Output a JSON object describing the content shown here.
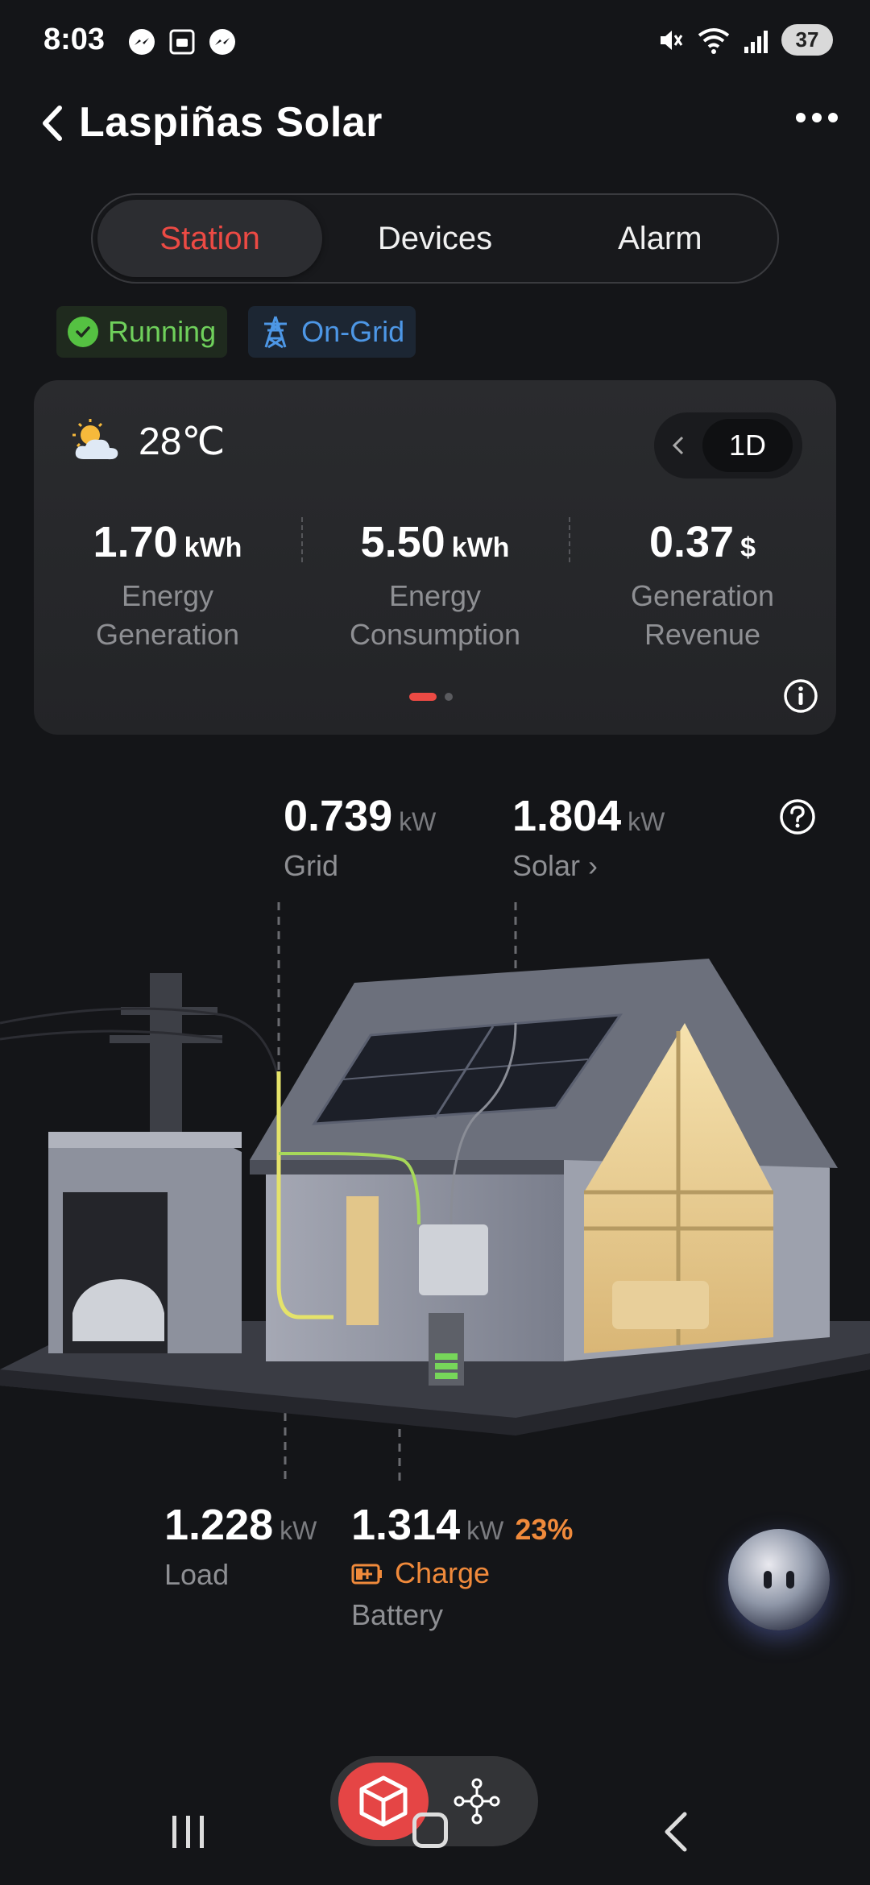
{
  "status_bar": {
    "time": "8:03",
    "battery": "37",
    "icons": [
      "messenger-icon",
      "screenshot-icon",
      "messenger-icon",
      "mute-icon",
      "wifi-icon",
      "signal-icon"
    ]
  },
  "header": {
    "title": "Laspiñas Solar"
  },
  "tabs": [
    {
      "label": "Station",
      "active": true
    },
    {
      "label": "Devices",
      "active": false
    },
    {
      "label": "Alarm",
      "active": false
    }
  ],
  "chips": {
    "running": "Running",
    "on_grid": "On-Grid"
  },
  "energy_card": {
    "temperature": "28",
    "temperature_unit": "℃",
    "period": "1D",
    "metrics": [
      {
        "value": "1.70",
        "unit": "kWh",
        "label_line1": "Energy",
        "label_line2": "Generation"
      },
      {
        "value": "5.50",
        "unit": "kWh",
        "label_line1": "Energy",
        "label_line2": "Consumption"
      },
      {
        "value": "0.37",
        "unit": "$",
        "label_line1": "Generation",
        "label_line2": "Revenue"
      }
    ]
  },
  "flow": {
    "grid": {
      "value": "0.739",
      "unit": "kW",
      "label": "Grid"
    },
    "solar": {
      "value": "1.804",
      "unit": "kW",
      "label": "Solar ›"
    },
    "load": {
      "value": "1.228",
      "unit": "kW",
      "label": "Load"
    },
    "battery": {
      "value": "1.314",
      "unit": "kW",
      "soc": "23%",
      "status": "Charge",
      "label": "Battery"
    }
  },
  "colors": {
    "accent_red": "#ec4a44",
    "running_green": "#6fd05b",
    "grid_blue": "#4d97e6",
    "charge_orange": "#f08a3b"
  }
}
